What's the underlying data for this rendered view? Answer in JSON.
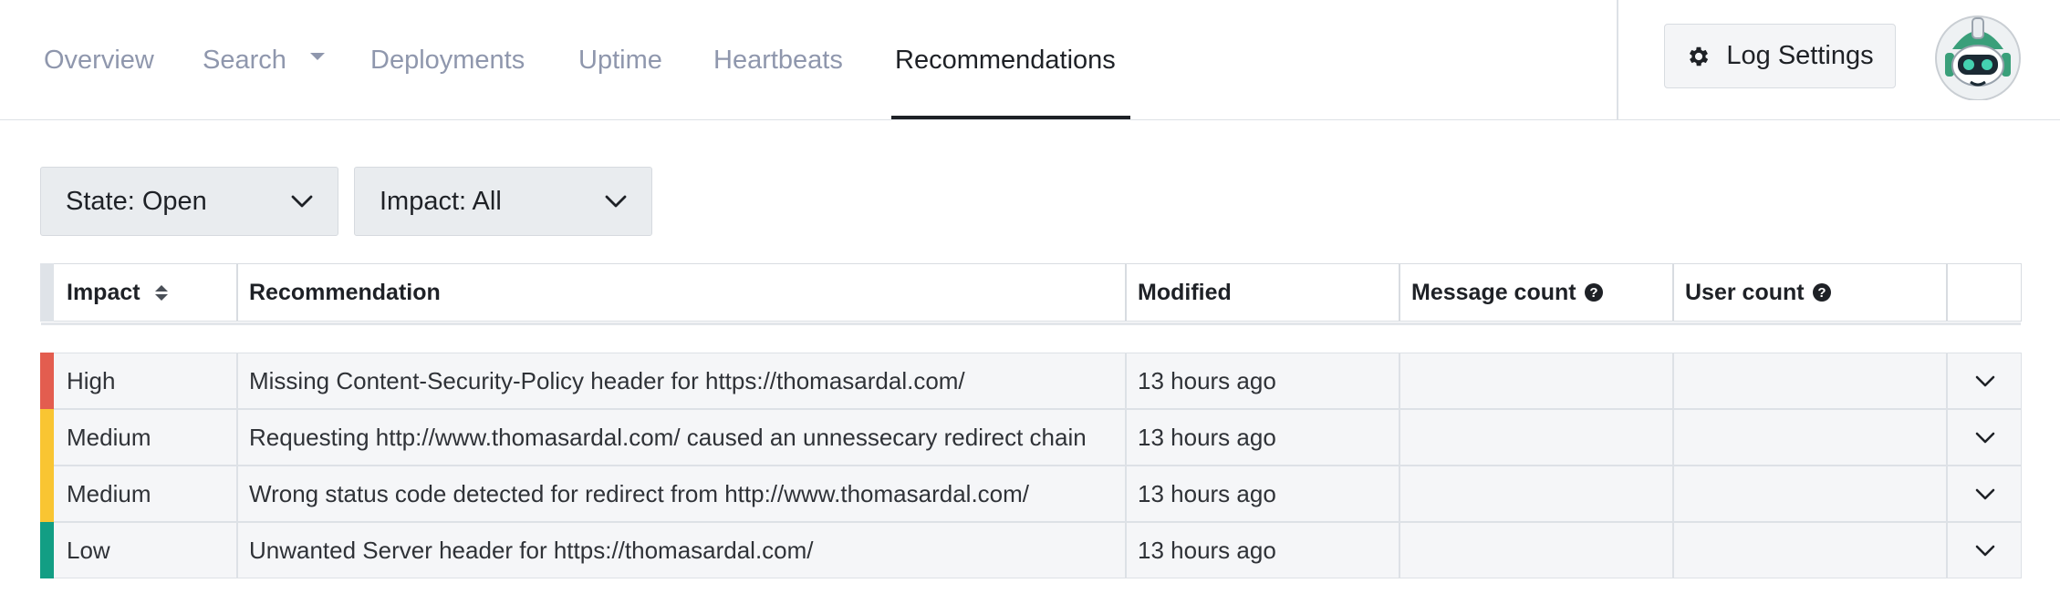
{
  "nav": {
    "tabs": [
      {
        "label": "Overview"
      },
      {
        "label": "Search"
      },
      {
        "label": "Deployments"
      },
      {
        "label": "Uptime"
      },
      {
        "label": "Heartbeats"
      },
      {
        "label": "Recommendations"
      }
    ],
    "active_tab": "Recommendations",
    "log_settings_label": "Log Settings",
    "avatar_icon": "robot-avatar-icon"
  },
  "filters": {
    "state_label": "State: Open",
    "impact_label": "Impact: All"
  },
  "table": {
    "headers": {
      "impact": "Impact",
      "recommendation": "Recommendation",
      "modified": "Modified",
      "message_count": "Message count",
      "user_count": "User count"
    },
    "rows": [
      {
        "impact": "High",
        "impact_color": "#e35d4f",
        "recommendation": "Missing Content-Security-Policy header for https://thomasardal.com/",
        "modified": "13 hours ago",
        "message_count": "",
        "user_count": ""
      },
      {
        "impact": "Medium",
        "impact_color": "#f9c532",
        "recommendation": "Requesting http://www.thomasardal.com/ caused an unnessecary redirect chain",
        "modified": "13 hours ago",
        "message_count": "",
        "user_count": ""
      },
      {
        "impact": "Medium",
        "impact_color": "#f9c532",
        "recommendation": "Wrong status code detected for redirect from http://www.thomasardal.com/",
        "modified": "13 hours ago",
        "message_count": "",
        "user_count": ""
      },
      {
        "impact": "Low",
        "impact_color": "#129e84",
        "recommendation": "Unwanted Server header for https://thomasardal.com/",
        "modified": "13 hours ago",
        "message_count": "",
        "user_count": ""
      }
    ]
  }
}
